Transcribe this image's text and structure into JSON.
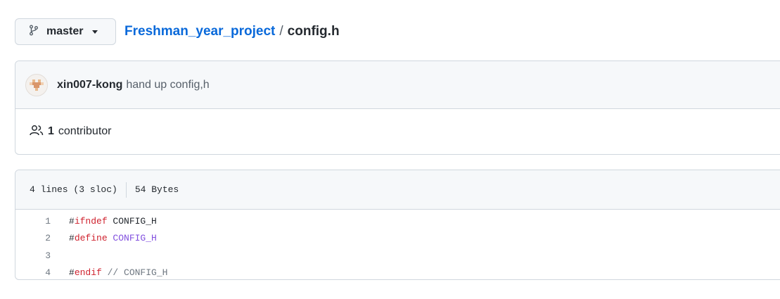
{
  "branch": {
    "label": "master",
    "icon": "git-branch-icon"
  },
  "breadcrumb": {
    "repo": "Freshman_year_project",
    "separator": "/",
    "file": "config.h"
  },
  "commit": {
    "author": "xin007-kong",
    "message": "hand up config,h"
  },
  "contributors": {
    "count": "1",
    "label": "contributor"
  },
  "file_info": {
    "lines": "4 lines (3 sloc)",
    "size": "54 Bytes"
  },
  "code": {
    "line_numbers": [
      "1",
      "2",
      "3",
      "4"
    ],
    "line1": {
      "hash": "#",
      "kw": "ifndef",
      "rest": " CONFIG_H"
    },
    "line2": {
      "hash": "#",
      "kw": "define",
      "rest": " CONFIG_H"
    },
    "line4": {
      "hash": "#",
      "kw": "endif",
      "rest": " // CONFIG_H"
    }
  },
  "colors": {
    "link": "#0969da",
    "keyword": "#cf222e",
    "constant": "#8250df",
    "comment": "#6e7781"
  }
}
